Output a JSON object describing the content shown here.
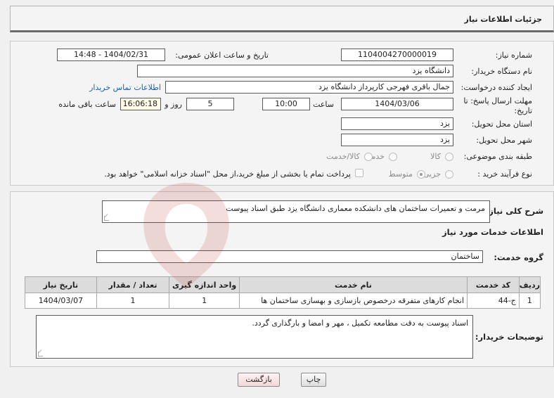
{
  "header": {
    "title": "جزئیات اطلاعات نیاز"
  },
  "form": {
    "need_number_label": "شماره نیاز:",
    "need_number": "1104004270000019",
    "announce_label": "تاریخ و ساعت اعلان عمومی:",
    "announce_value": "1404/02/31 - 14:48",
    "buyer_org_label": "نام دستگاه خریدار:",
    "buyer_org": "دانشگاه یزد",
    "creator_label": "ایجاد کننده درخواست:",
    "creator": "جمال باقری فهرجی کارپرداز دانشگاه یزد",
    "contact_link": "اطلاعات تماس خریدار",
    "deadline_label_1": "مهلت ارسال پاسخ: تا",
    "deadline_label_2": "تاریخ:",
    "deadline_date": "1404/03/06",
    "time_label": "ساعت",
    "deadline_time": "10:00",
    "days_value": "5",
    "days_label": "روز و",
    "remaining_time": "16:06:18",
    "remaining_label": "ساعت باقی مانده",
    "province_label": "استان محل تحویل:",
    "province": "یزد",
    "city_label": "شهر محل تحویل:",
    "city": "یزد",
    "category_label": "طبقه بندی موضوعی:",
    "category_options": [
      "کالا",
      "خدمت",
      "کالا/خدمت"
    ],
    "process_label": "نوع فرآیند خرید :",
    "process_options": [
      "جزیی",
      "متوسط"
    ],
    "payment_note": "پرداخت تمام یا بخشی از مبلغ خرید،از محل \"اسناد خزانه اسلامی\" خواهد بود."
  },
  "details": {
    "summary_label": "شرح کلی نیاز:",
    "summary": "مرمت و تعمیرات ساختمان های دانشکده معماری دانشگاه یزد طبق اسناد پیوست",
    "services_title": "اطلاعات خدمات مورد نیاز",
    "service_group_label": "گروه خدمت:",
    "service_group": "ساختمان",
    "table": {
      "headers": [
        "ردیف",
        "کد خدمت",
        "نام خدمت",
        "واحد اندازه گیری",
        "تعداد / مقدار",
        "تاریخ نیاز"
      ],
      "rows": [
        [
          "1",
          "ج-44",
          "انجام کارهای متفرقه درخصوص بازسازی و بهسازی ساختمان ها",
          "1",
          "1",
          "1404/03/07"
        ]
      ]
    },
    "buyer_notes_label": "توضیحات خریدار:",
    "buyer_notes": "اسناد پیوست به دقت مطامعه تکمیل ، مهر و امضا و بارگذاری گردد."
  },
  "buttons": {
    "print": "چاپ",
    "back": "بازگشت"
  },
  "colors": {
    "link": "#1a5fb4",
    "watermark": "#c0392b"
  }
}
